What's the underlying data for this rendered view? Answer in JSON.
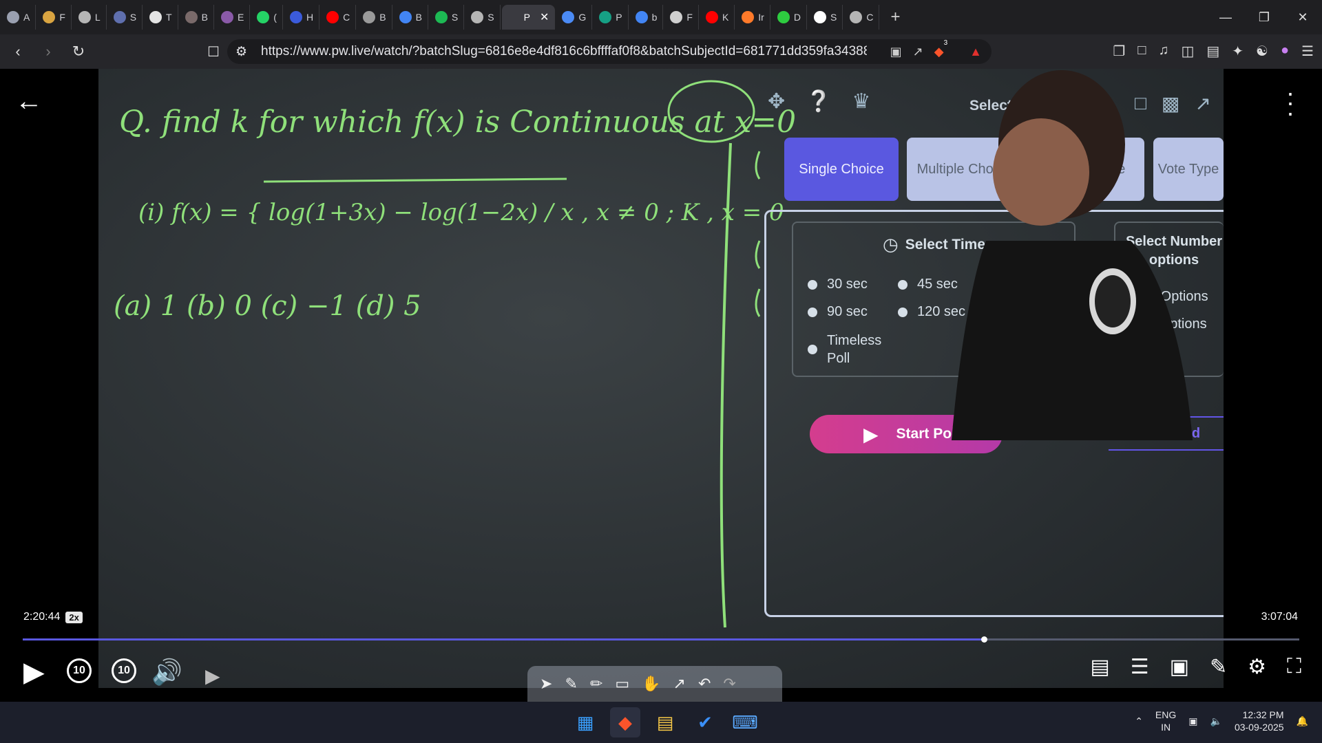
{
  "browser": {
    "tabs": [
      {
        "label": "A",
        "color": "#9aa0b0"
      },
      {
        "label": "F",
        "color": "#d9a441"
      },
      {
        "label": "L",
        "color": "#b5b5b5"
      },
      {
        "label": "S",
        "color": "#5f6fae"
      },
      {
        "label": "T",
        "color": "#e4e4e4"
      },
      {
        "label": "B",
        "color": "#7a6a6a"
      },
      {
        "label": "E",
        "color": "#8a5aa8"
      },
      {
        "label": "(",
        "color": "#25d366"
      },
      {
        "label": "H",
        "color": "#3b5bdb"
      },
      {
        "label": "C",
        "color": "#ff0000"
      },
      {
        "label": "B",
        "color": "#9a9a9a"
      },
      {
        "label": "B",
        "color": "#4285f4"
      },
      {
        "label": "S",
        "color": "#1db954"
      },
      {
        "label": "S",
        "color": "#b5b5b5"
      },
      {
        "label": "P",
        "color": "#3a3a40",
        "active": true
      },
      {
        "label": "G",
        "color": "#4b8bf5"
      },
      {
        "label": "P",
        "color": "#16a085"
      },
      {
        "label": "b",
        "color": "#4285f4"
      },
      {
        "label": "F",
        "color": "#cfcfcf"
      },
      {
        "label": "K",
        "color": "#ff0000"
      },
      {
        "label": "Ir",
        "color": "#ff7a2a"
      },
      {
        "label": "D",
        "color": "#2ecc40"
      },
      {
        "label": "S",
        "color": "#ffffff"
      },
      {
        "label": "C",
        "color": "#b5b5b5"
      }
    ],
    "new_tab_symbol": "+",
    "url": "https://www.pw.live/watch/?batchSlug=6816e8e4df816c6bffffaf0f8&batchSubjectId=681771dd359fa34388d823e...",
    "shield_count": "3"
  },
  "board": {
    "question_line": "Q. find k for which f(x) is Continuous at x=0",
    "function_def": "(i) f(x) = { log(1+3x) − log(1−2x) / x , x ≠ 0 ; K , x = 0",
    "options_line": "(a) 1   (b) 0   (c) −1   (d) 5"
  },
  "poll": {
    "title": "Select Poll Type",
    "types": [
      {
        "label": "Single Choice",
        "selected": true
      },
      {
        "label": "Multiple Choice",
        "selected": false
      },
      {
        "label": "Integer Type",
        "selected": false
      },
      {
        "label": "Vote Type",
        "selected": false
      }
    ],
    "timer_title": "Select Timer",
    "timers": [
      "30 sec",
      "45 sec",
      "90 sec",
      "120 sec",
      "Timeless Poll"
    ],
    "number_title": "Select Number options",
    "number_options": [
      {
        "label": "4 Options",
        "selected": true
      },
      {
        "label": "5 Options",
        "selected": false
      }
    ],
    "start_label": "Start Poll",
    "leaderboard_label": "Leaderboard"
  },
  "player": {
    "current_time": "2:20:44",
    "speed": "2x",
    "total_time": "3:07:04",
    "progress": 0.753,
    "skip_back": "10",
    "skip_forward": "10"
  },
  "taskbar": {
    "lang_top": "ENG",
    "lang_bottom": "IN",
    "time": "12:32 PM",
    "date": "03-09-2025"
  }
}
